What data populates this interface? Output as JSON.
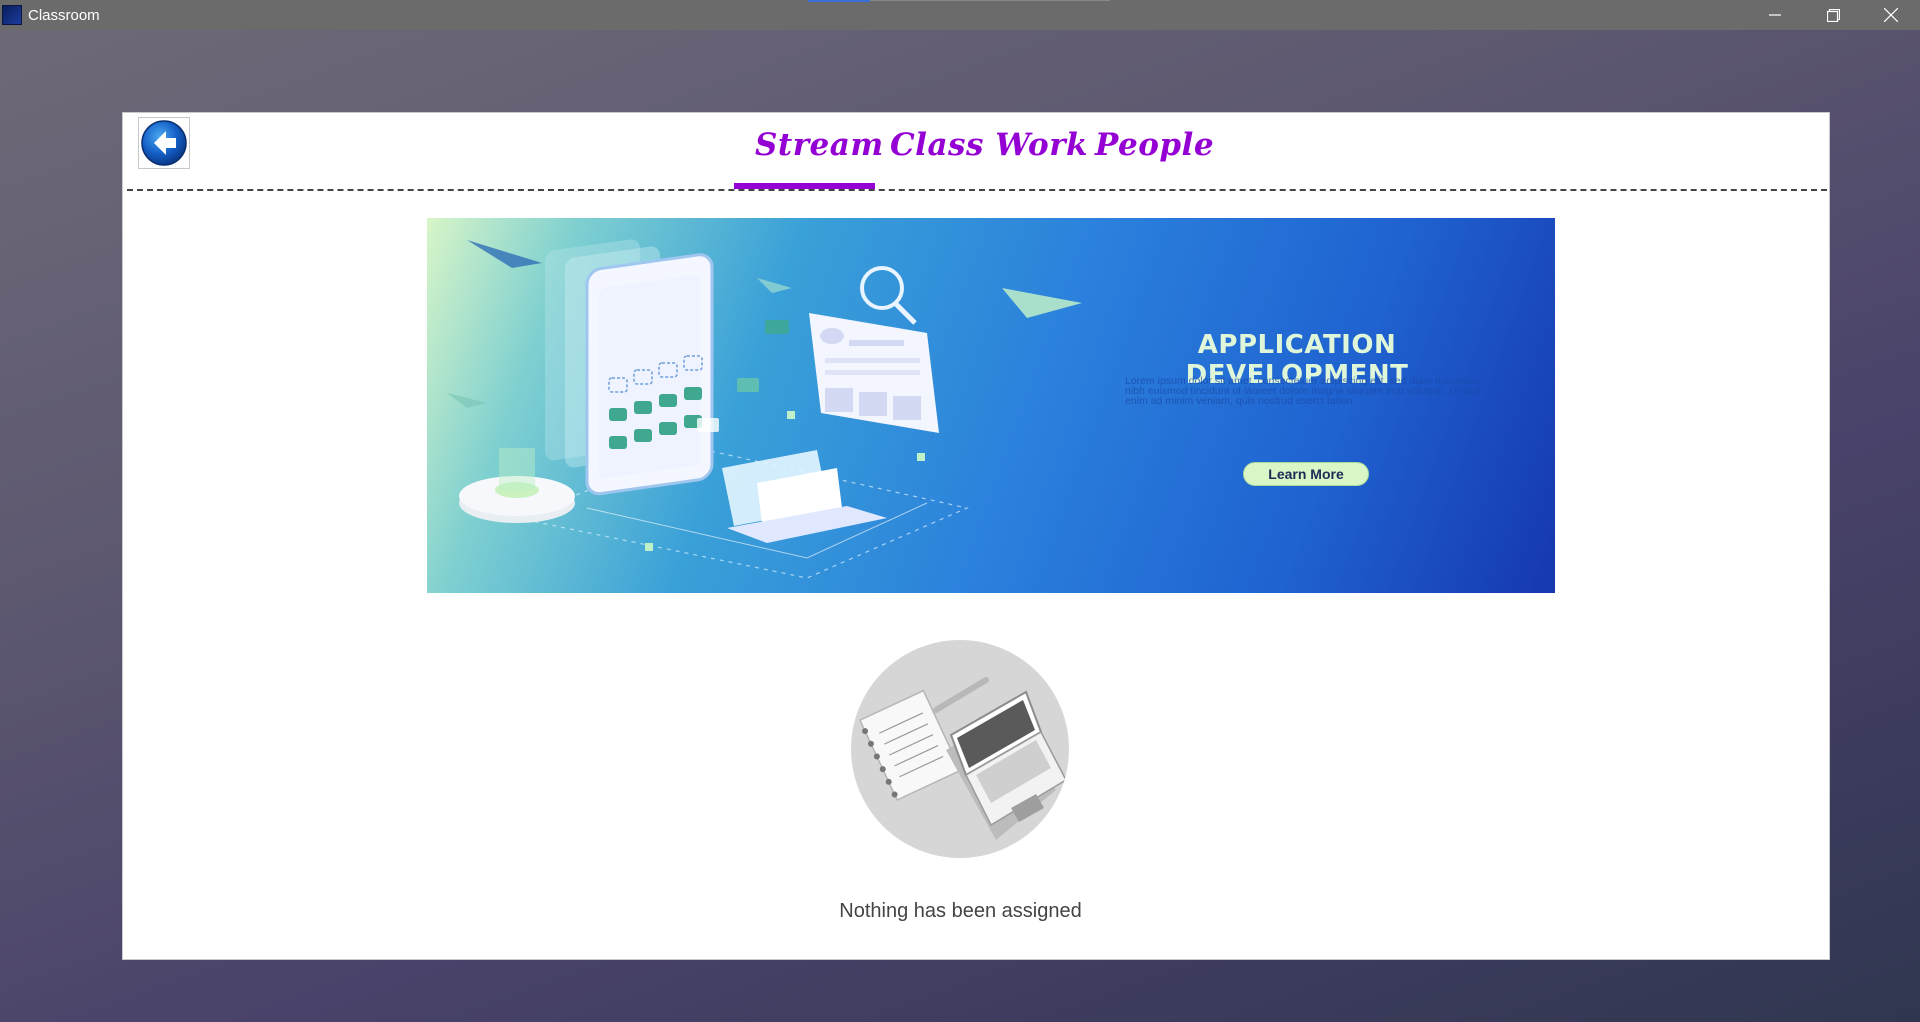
{
  "window": {
    "title": "Classroom",
    "icon": "app-icon",
    "controls": [
      "minimize-icon",
      "restore-icon",
      "close-icon"
    ]
  },
  "nav": {
    "back_icon": "back-arrow-icon",
    "tabs": [
      {
        "label": "Stream",
        "active": true
      },
      {
        "label": "Class Work",
        "active": false
      },
      {
        "label": "People",
        "active": false
      }
    ],
    "accent_color": "#9400d3"
  },
  "banner": {
    "title": "APPLICATION DEVELOPMENT",
    "body": "Lorem ipsum dolor sit amet, consectetuer adipiscing elit, sed diam nonummy nibh euismod tincidunt ut laoreet dolore magna aliquam erat volutpat. Ut wisi enim ad minim veniam, quis nostrud exerci tation",
    "button_label": "Learn More"
  },
  "empty_state": {
    "message": "Nothing has been assigned",
    "illustration": "notebook-and-laptop-illustration"
  }
}
